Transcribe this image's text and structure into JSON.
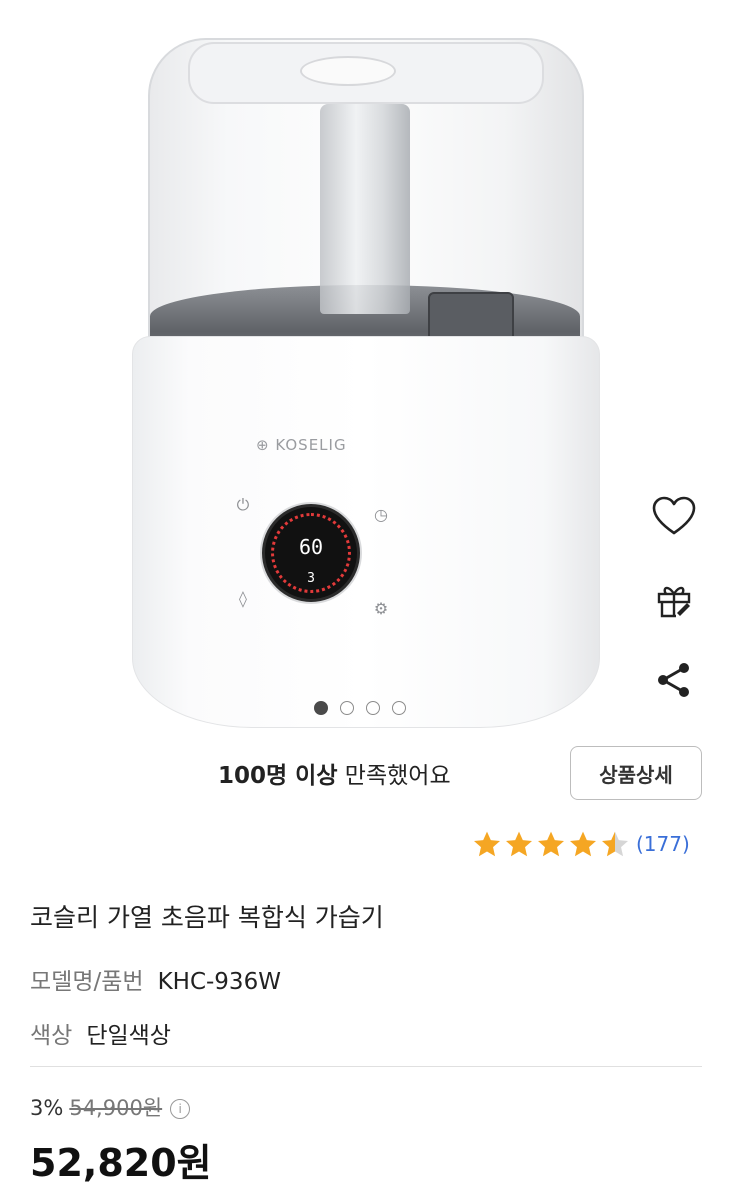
{
  "product_image": {
    "brand_text": "KOSELIG",
    "display_value": "60",
    "display_sub": "3"
  },
  "gallery": {
    "page_count": 4,
    "active_index": 0
  },
  "side_actions": [
    "heart-icon",
    "gift-icon",
    "share-icon"
  ],
  "satisfaction": {
    "strong": "100명 이상",
    "rest": " 만족했어요"
  },
  "detail_button": "상품상세",
  "rating": {
    "stars": 4.5,
    "count": "(177)"
  },
  "product": {
    "title": "코슬리 가열 초음파 복합식 가습기",
    "model_label": "모델명/품번",
    "model_value": "KHC-936W",
    "color_label": "색상",
    "color_value": "단일색상"
  },
  "price": {
    "discount_rate": "3%",
    "original": "54,900원",
    "final": "52,820원"
  },
  "colors": {
    "star": "#f5a623",
    "link": "#3a6fd8"
  }
}
